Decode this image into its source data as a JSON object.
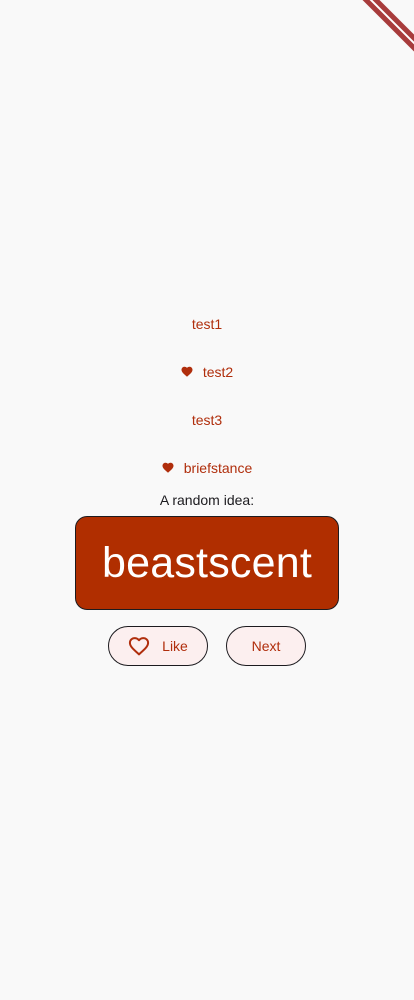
{
  "history": [
    {
      "label": "test1",
      "liked": false
    },
    {
      "label": "test2",
      "liked": true
    },
    {
      "label": "test3",
      "liked": false
    },
    {
      "label": "briefstance",
      "liked": true
    }
  ],
  "prompt": "A random idea:",
  "idea": "beastscent",
  "buttons": {
    "like_label": "Like",
    "like_icon": "heart-outline-icon",
    "next_label": "Next"
  },
  "colors": {
    "background": "#f9f9f9",
    "accent": "#b02e0c",
    "card": "#b02e00",
    "button_bg": "#fcefef"
  },
  "debug_banner": true
}
